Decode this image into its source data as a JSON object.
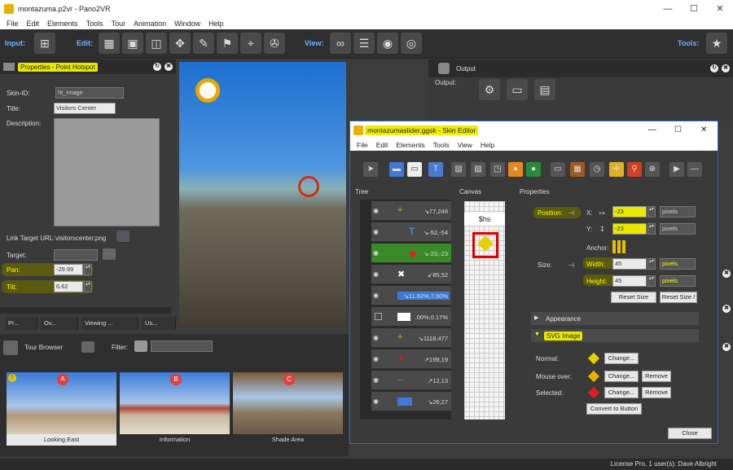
{
  "window": {
    "title": "montazuma.p2vr - Pano2VR",
    "minimize": "—",
    "maximize": "☐",
    "close": "✕"
  },
  "menu": [
    "File",
    "Edit",
    "Elements",
    "Tools",
    "Tour",
    "Animation",
    "Window",
    "Help"
  ],
  "toolbar": {
    "input_label": "Input:",
    "edit_label": "Edit:",
    "view_label": "View:",
    "tools_label": "Tools:"
  },
  "properties": {
    "title": "Properties - Point Hotspot",
    "skin_id_label": "Skin-ID:",
    "skin_id_value": "ht_image",
    "title_label": "Title:",
    "title_value": "Visitors Center",
    "description_label": "Description:",
    "link_label": "Link Target URL:",
    "link_value": "visitorscenter.png",
    "target_label": "Target:",
    "pan_label": "Pan:",
    "pan_value": "-29.99",
    "tilt_label": "Tilt:",
    "tilt_value": "6.62"
  },
  "bottom_tabs": [
    "Pr...",
    "Ov...",
    "Viewing ...",
    "Us..."
  ],
  "tour_browser": {
    "title": "Tour Browser",
    "filter_label": "Filter:",
    "thumbs": [
      {
        "badge": "A",
        "caption": "Looking East"
      },
      {
        "badge": "B",
        "caption": "Information"
      },
      {
        "badge": "C",
        "caption": "Shade Area"
      }
    ]
  },
  "output": {
    "title": "Output",
    "output_label": "Output:"
  },
  "skin_editor": {
    "title": "montazumaslider.ggsk - Skin Editor",
    "minimize": "—",
    "maximize": "☐",
    "close": "✕",
    "menu": [
      "File",
      "Edit",
      "Elements",
      "Tools",
      "View",
      "Help"
    ],
    "tree_label": "Tree",
    "canvas_label": "Canvas",
    "properties_label": "Properties",
    "canvas_text": "$hs",
    "tree_rows": [
      {
        "icon": "✛",
        "value": "↘77,248"
      },
      {
        "icon": "T",
        "value": "↘-52,-54"
      },
      {
        "icon": "◆",
        "value": "↘-23,-23"
      },
      {
        "icon": "✖",
        "value": "↙85,52"
      },
      {
        "icon": "",
        "value": "↘11.92%,7.50%"
      },
      {
        "icon": "",
        "value": ".00%,0.17%"
      },
      {
        "icon": "✛",
        "value": "↘1118,477"
      },
      {
        "icon": "✗",
        "value": "↗199,19"
      },
      {
        "icon": "—",
        "value": "↗12,13"
      },
      {
        "icon": "",
        "value": "↘26,27"
      }
    ],
    "position_label": "Position:",
    "x_label": "X:",
    "x_value": "-23",
    "y_label": "Y:",
    "y_value": "-23",
    "unit_pixels": "pixels",
    "anchor_label": "Anchor:",
    "size_label": "Size:",
    "width_label": "Width:",
    "width_value": "45",
    "height_label": "Height:",
    "height_value": "45",
    "reset_size": "Reset Size",
    "reset_size2": "Reset Size /",
    "appearance_label": "Appearance",
    "svg_label": "SVG Image",
    "normal_label": "Normal:",
    "mouseover_label": "Mouse over:",
    "selected_label": "Selected:",
    "change_label": "Change...",
    "remove_label": "Remove",
    "convert_label": "Convert to Button",
    "close_label": "Close"
  },
  "status": "License Pro, 1 user(s): Dave Albright"
}
